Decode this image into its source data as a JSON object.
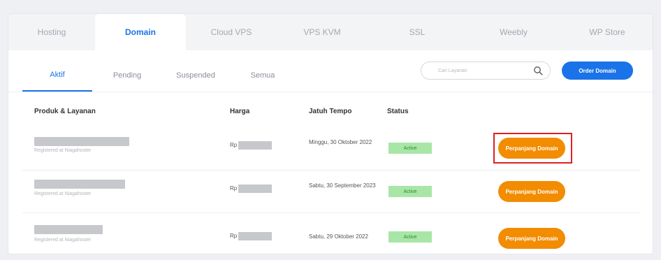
{
  "top_tabs": [
    {
      "label": "Hosting",
      "active": false
    },
    {
      "label": "Domain",
      "active": true
    },
    {
      "label": "Cloud VPS",
      "active": false
    },
    {
      "label": "VPS KVM",
      "active": false
    },
    {
      "label": "SSL",
      "active": false
    },
    {
      "label": "Weebly",
      "active": false
    },
    {
      "label": "WP Store",
      "active": false
    }
  ],
  "sub_tabs": [
    {
      "label": "Aktif",
      "active": true
    },
    {
      "label": "Pending",
      "active": false
    },
    {
      "label": "Suspended",
      "active": false
    },
    {
      "label": "Semua",
      "active": false
    }
  ],
  "search": {
    "placeholder": "Cari Layanan",
    "icon": "search-icon"
  },
  "order_button": "Order Domain",
  "table": {
    "headers": {
      "product": "Produk & Layanan",
      "price": "Harga",
      "due": "Jatuh Tempo",
      "status": "Status"
    },
    "rows": [
      {
        "registered": "Registered at Niagahoster",
        "price_prefix": "Rp",
        "due": "Minggu, 30 Oktober 2022",
        "status": "Active",
        "action": "Perpanjang Domain",
        "highlighted": true
      },
      {
        "registered": "Registered at Niagahoster",
        "price_prefix": "Rp",
        "due": "Sabtu, 30 September 2023",
        "status": "Active",
        "action": "Perpanjang Domain",
        "highlighted": false
      },
      {
        "registered": "Registered at Niagahoster",
        "price_prefix": "Rp",
        "due": "Sabtu, 29 Oktober 2022",
        "status": "Active",
        "action": "Perpanjang Domain",
        "highlighted": false
      }
    ]
  },
  "colors": {
    "accent": "#1a73e8",
    "action": "#f28c00",
    "status_bg": "#a8e6a8",
    "highlight": "#e02020"
  }
}
